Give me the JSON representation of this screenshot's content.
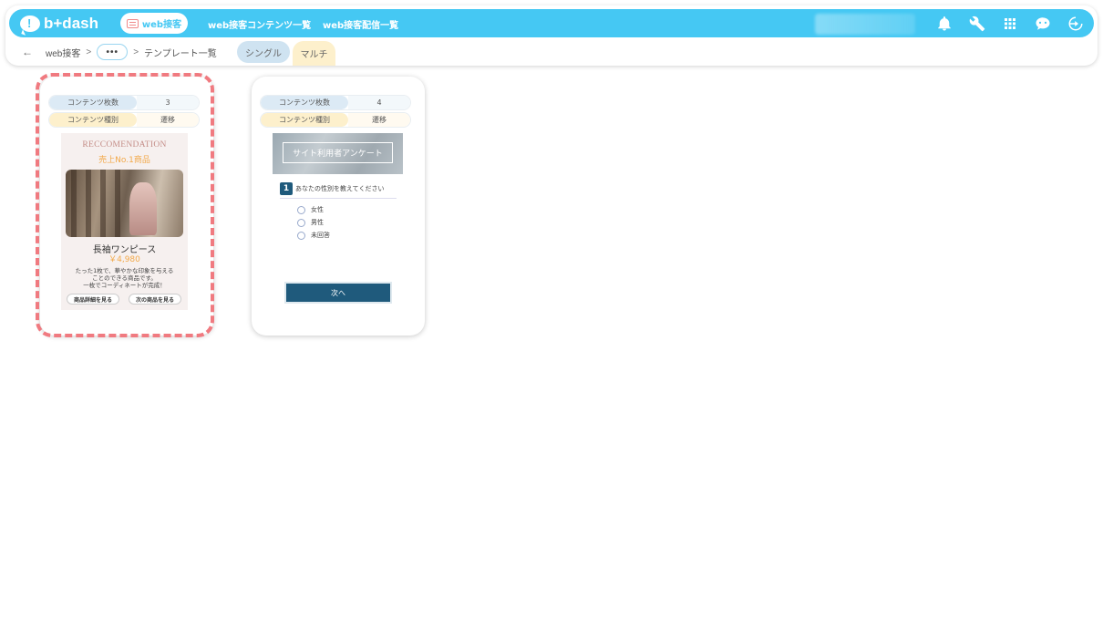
{
  "app": {
    "brand": "b+dash",
    "logo_mark": "!",
    "active_section": "web接客",
    "nav_links": [
      "web接客コンテンツ一覧",
      "web接客配信一覧"
    ],
    "colors": {
      "accent": "#45c8f3",
      "highlight": "#f07a80",
      "survey_primary": "#1f5a7c"
    },
    "top_icons": [
      "bell-icon",
      "wrench-icon",
      "grid-icon",
      "chat-robot-icon",
      "logout-icon"
    ]
  },
  "breadcrumb": {
    "back": "←",
    "root": "web接客",
    "sep1": ">",
    "ellipsis": "•••",
    "sep2": ">",
    "current": "テンプレート一覧"
  },
  "tabs": {
    "single": "シングル",
    "multi": "マルチ"
  },
  "cards": [
    {
      "count_label": "コンテンツ枚数",
      "count_value": "3",
      "type_label": "コンテンツ種別",
      "type_value": "遷移",
      "preview": {
        "heading": "RECCOMENDATION",
        "subheading": "売上No.1商品",
        "product_name": "長袖ワンピース",
        "price": "￥4,980",
        "desc_lines": [
          "たった1枚で、華やかな印象を与える",
          "ことのできる商品です。",
          "一枚でコーディネートが完成！"
        ],
        "btn_detail": "商品詳細を見る",
        "btn_next": "次の商品を見る"
      }
    },
    {
      "count_label": "コンテンツ枚数",
      "count_value": "4",
      "type_label": "コンテンツ種別",
      "type_value": "遷移",
      "preview": {
        "title": "サイト利用者アンケート",
        "q_number": "1",
        "question": "あなたの性別を教えてください",
        "options": [
          "女性",
          "男性",
          "未回答"
        ],
        "next": "次へ"
      }
    }
  ]
}
